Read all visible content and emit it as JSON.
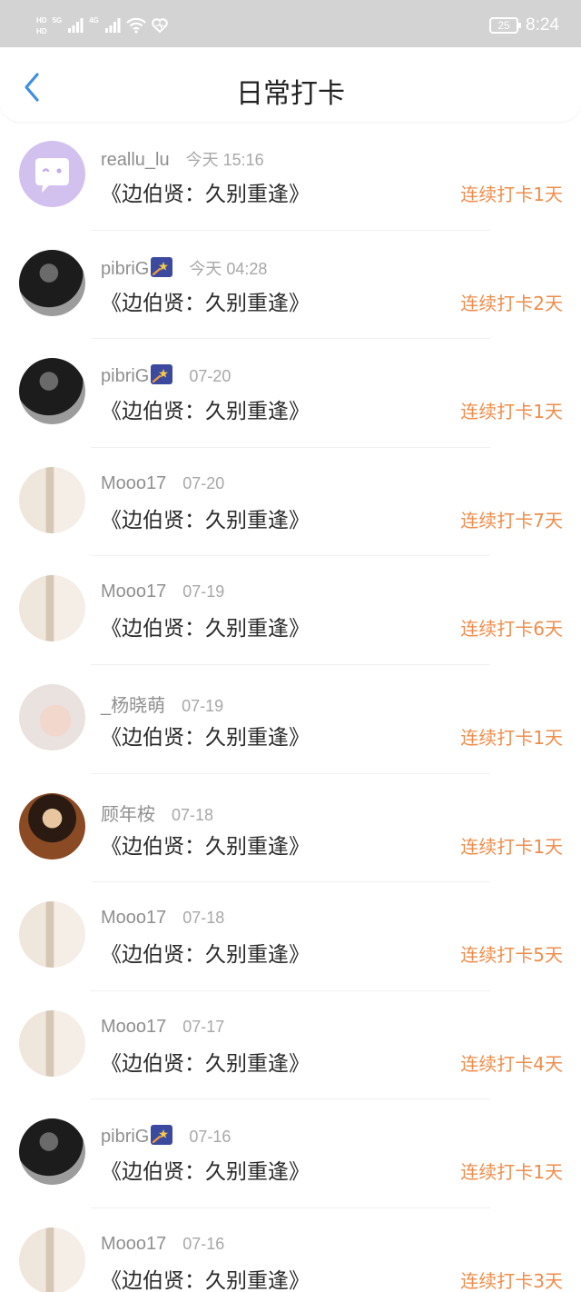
{
  "status_bar": {
    "hd1": "HD",
    "hd2": "HD",
    "net1": "5G",
    "net2": "4G",
    "battery": "25",
    "time": "8:24"
  },
  "header": {
    "title": "日常打卡",
    "back_icon": "chevron-left-icon"
  },
  "checkins": [
    {
      "username": "reallu_lu",
      "emoji": false,
      "time": "今天 15:16",
      "book": "《边伯贤：久别重逢》",
      "streak": "连续打卡1天",
      "avatar": "av-a"
    },
    {
      "username": "pibriG",
      "emoji": true,
      "time": "今天 04:28",
      "book": "《边伯贤：久别重逢》",
      "streak": "连续打卡2天",
      "avatar": "av-b"
    },
    {
      "username": "pibriG",
      "emoji": true,
      "time": "07-20",
      "book": "《边伯贤：久别重逢》",
      "streak": "连续打卡1天",
      "avatar": "av-b"
    },
    {
      "username": "Mooo17",
      "emoji": false,
      "time": "07-20",
      "book": "《边伯贤：久别重逢》",
      "streak": "连续打卡7天",
      "avatar": "av-c"
    },
    {
      "username": "Mooo17",
      "emoji": false,
      "time": "07-19",
      "book": "《边伯贤：久别重逢》",
      "streak": "连续打卡6天",
      "avatar": "av-c"
    },
    {
      "username": "_杨晓萌",
      "emoji": false,
      "time": "07-19",
      "book": "《边伯贤：久别重逢》",
      "streak": "连续打卡1天",
      "avatar": "av-d"
    },
    {
      "username": "顾年桉",
      "emoji": false,
      "time": "07-18",
      "book": "《边伯贤：久别重逢》",
      "streak": "连续打卡1天",
      "avatar": "av-e"
    },
    {
      "username": "Mooo17",
      "emoji": false,
      "time": "07-18",
      "book": "《边伯贤：久别重逢》",
      "streak": "连续打卡5天",
      "avatar": "av-c"
    },
    {
      "username": "Mooo17",
      "emoji": false,
      "time": "07-17",
      "book": "《边伯贤：久别重逢》",
      "streak": "连续打卡4天",
      "avatar": "av-c"
    },
    {
      "username": "pibriG",
      "emoji": true,
      "time": "07-16",
      "book": "《边伯贤：久别重逢》",
      "streak": "连续打卡1天",
      "avatar": "av-b"
    },
    {
      "username": "Mooo17",
      "emoji": false,
      "time": "07-16",
      "book": "《边伯贤：久别重逢》",
      "streak": "连续打卡3天",
      "avatar": "av-c"
    }
  ]
}
